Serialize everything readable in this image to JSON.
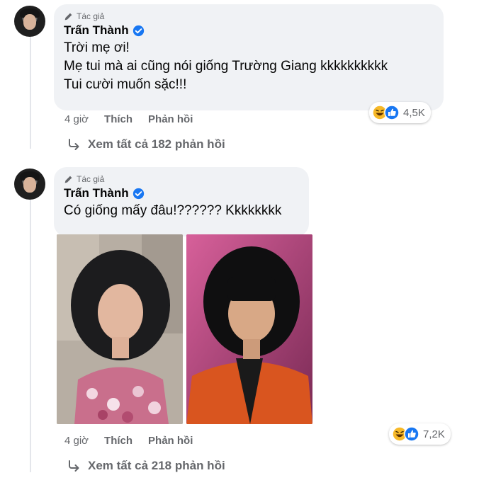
{
  "comments": [
    {
      "author_tag": "Tác giả",
      "author_name": "Trấn Thành",
      "lines": [
        "Trời mẹ ơi!",
        "Mẹ tui mà ai cũng nói giống Trường Giang kkkkkkkkkk",
        "Tui cười muốn sặc!!!"
      ],
      "time": "4 giờ",
      "like_label": "Thích",
      "reply_label": "Phản hồi",
      "reaction_count": "4,5K",
      "view_replies": "Xem tất cả 182 phản hồi"
    },
    {
      "author_tag": "Tác giả",
      "author_name": "Trấn Thành",
      "lines": [
        "Có giống mấy đâu!?????? Kkkkkkkk"
      ],
      "time": "4 giờ",
      "like_label": "Thích",
      "reply_label": "Phản hồi",
      "reaction_count": "7,2K",
      "view_replies": "Xem tất cả 218 phản hồi"
    }
  ],
  "colors": {
    "bubble_bg": "#f0f2f5",
    "secondary_text": "#65676b",
    "like_blue": "#1877f2",
    "haha_yellow": "#f7b928"
  },
  "icons": [
    "pencil-icon",
    "verified-badge-icon",
    "haha-reaction-icon",
    "like-reaction-icon",
    "reply-arrow-icon"
  ]
}
